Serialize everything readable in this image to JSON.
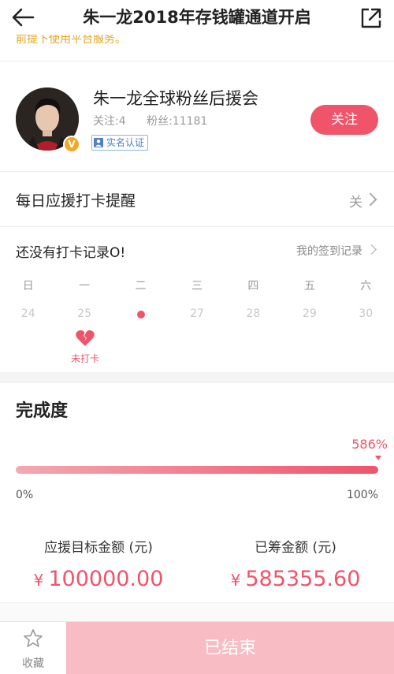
{
  "header": {
    "title": "朱一龙2018年存钱罐通道开启",
    "back_icon": "back-arrow-icon",
    "share_icon": "share-external-icon"
  },
  "notice": {
    "text": "前提下使用平台服务。"
  },
  "profile": {
    "club_name": "朱一龙全球粉丝后援会",
    "following_text": "关注:4",
    "fans_text": "粉丝:11181",
    "verified_label": "实名认证",
    "vip_badge": "V",
    "follow_label": "关注"
  },
  "reminder": {
    "label": "每日应援打卡提醒",
    "state": "关"
  },
  "checkin": {
    "status_text": "还没有打卡记录O!",
    "records_link": "我的签到记录",
    "weekdays": [
      "日",
      "一",
      "二",
      "三",
      "四",
      "五",
      "六"
    ],
    "dates": [
      "24",
      "25",
      "",
      "27",
      "28",
      "29",
      "30"
    ],
    "missed_label": "未打卡"
  },
  "completion": {
    "title": "完成度",
    "percent_label": "586%",
    "fill_fraction": 1.0,
    "scale_min": "0%",
    "scale_max": "100%"
  },
  "amounts": {
    "target_caption": "应援目标金额 (元)",
    "target_value": "100000.00",
    "raised_caption": "已筹金额 (元)",
    "raised_value": "585355.60",
    "currency_symbol": "¥"
  },
  "bottom": {
    "favorite_label": "收藏",
    "ended_label": "已结束"
  },
  "colors": {
    "accent": "#f0546a",
    "ended_button": "#f7bcc4",
    "notice": "#e3a51c",
    "verified": "#4f7fc5"
  }
}
